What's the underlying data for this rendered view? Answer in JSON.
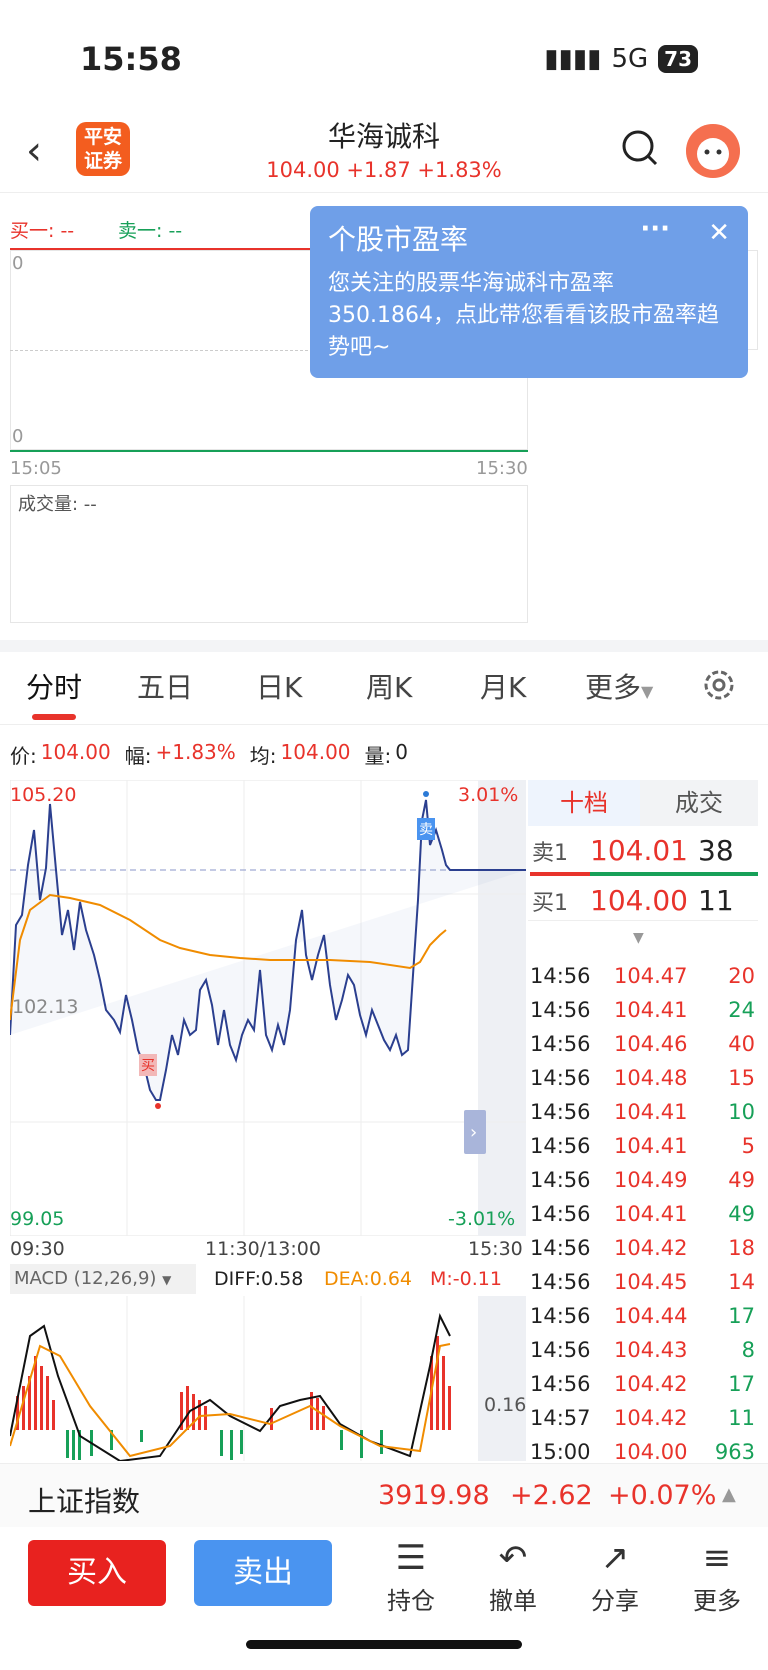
{
  "status": {
    "time": "15:58",
    "network": "5G",
    "battery": "73"
  },
  "header": {
    "title": "华海诚科",
    "quote": "104.00  +1.87  +1.83%",
    "logo_text_1": "平安",
    "logo_text_2": "证券",
    "back_icon": "chevron-left-icon",
    "search_icon": "search-icon"
  },
  "top_panel": {
    "bid1": "买一: --",
    "ask1": "卖一: --",
    "y_top": "0",
    "y_bottom": "0",
    "t_start": "15:05",
    "t_end": "15:30",
    "volume": "成交量: --"
  },
  "popup": {
    "title": "个股市盈率",
    "text": "您关注的股票华海诚科市盈率350.1864，点此带您看看该股市盈率趋势吧~",
    "more": "···",
    "close": "✕"
  },
  "tabs": [
    "分时",
    "五日",
    "日K",
    "周K",
    "月K",
    "更多"
  ],
  "info_bar": {
    "price_label": "价:",
    "price": "104.00",
    "amp_label": "幅:",
    "amp": "+1.83%",
    "avg_label": "均:",
    "avg": "104.00",
    "vol_label": "量:",
    "vol": "0"
  },
  "chart_labels": {
    "high": "105.20",
    "mid": "102.13",
    "low": "99.05",
    "high_pct": "3.01%",
    "low_pct": "-3.01%",
    "t0": "09:30",
    "t1": "11:30/13:00",
    "t2": "15:30",
    "buy_mark": "买",
    "sell_mark": "卖"
  },
  "macd": {
    "label": "MACD (12,26,9)",
    "diff": "DIFF:0.58",
    "dea": "DEA:0.64",
    "m": "M:-0.11",
    "axis": "0.16"
  },
  "orderbook": {
    "tab1": "十档",
    "tab2": "成交",
    "ask": {
      "label": "卖1",
      "price": "104.01",
      "vol": "38"
    },
    "bid": {
      "label": "买1",
      "price": "104.00",
      "vol": "11"
    }
  },
  "ticks": [
    {
      "t": "14:56",
      "p": "104.47",
      "v": "20",
      "c": "red"
    },
    {
      "t": "14:56",
      "p": "104.41",
      "v": "24",
      "c": "green"
    },
    {
      "t": "14:56",
      "p": "104.46",
      "v": "40",
      "c": "red"
    },
    {
      "t": "14:56",
      "p": "104.48",
      "v": "15",
      "c": "red"
    },
    {
      "t": "14:56",
      "p": "104.41",
      "v": "10",
      "c": "green"
    },
    {
      "t": "14:56",
      "p": "104.41",
      "v": "5",
      "c": "red"
    },
    {
      "t": "14:56",
      "p": "104.49",
      "v": "49",
      "c": "red"
    },
    {
      "t": "14:56",
      "p": "104.41",
      "v": "49",
      "c": "green"
    },
    {
      "t": "14:56",
      "p": "104.42",
      "v": "18",
      "c": "red"
    },
    {
      "t": "14:56",
      "p": "104.45",
      "v": "14",
      "c": "red"
    },
    {
      "t": "14:56",
      "p": "104.44",
      "v": "17",
      "c": "green"
    },
    {
      "t": "14:56",
      "p": "104.43",
      "v": "8",
      "c": "green"
    },
    {
      "t": "14:56",
      "p": "104.42",
      "v": "17",
      "c": "green"
    },
    {
      "t": "14:57",
      "p": "104.42",
      "v": "11",
      "c": "green"
    },
    {
      "t": "15:00",
      "p": "104.00",
      "v": "963",
      "c": "green"
    }
  ],
  "index_bar": {
    "name": "上证指数",
    "value": "3919.98",
    "change": "+2.62",
    "pct": "+0.07%"
  },
  "actions": {
    "buy": "买入",
    "sell": "卖出",
    "hold": "持仓",
    "cancel": "撤单",
    "share": "分享",
    "more": "更多"
  }
}
